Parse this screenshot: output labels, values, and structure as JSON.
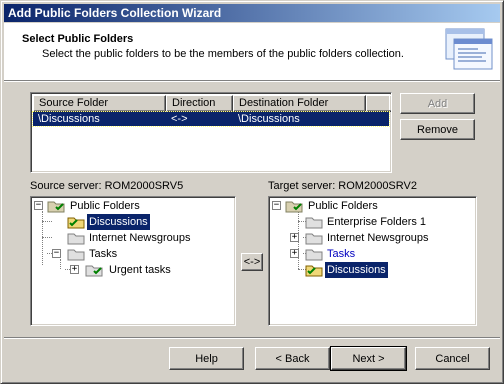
{
  "window": {
    "title": "Add Public Folders Collection Wizard"
  },
  "header": {
    "title": "Select Public Folders",
    "description": "Select the public folders to be the members of the public folders collection.",
    "graphic_icon": "wizard-window-graphic"
  },
  "collection_list": {
    "columns": [
      "Source Folder",
      "Direction",
      "Destination Folder"
    ],
    "rows": [
      {
        "source": "\\Discussions",
        "direction": "<->",
        "destination": "\\Discussions",
        "selected": true
      }
    ]
  },
  "buttons": {
    "add": "Add",
    "remove": "Remove",
    "transfer": "<->",
    "help": "Help",
    "back": "< Back",
    "next": "Next >",
    "cancel": "Cancel"
  },
  "source": {
    "label": "Source server: ROM2000SRV5",
    "tree": {
      "root": "Public Folders",
      "items": [
        {
          "label": "Discussions",
          "selected": true
        },
        {
          "label": "Internet Newsgroups"
        },
        {
          "label": "Tasks",
          "children": [
            {
              "label": "Urgent tasks"
            }
          ]
        }
      ]
    }
  },
  "target": {
    "label": "Target server: ROM2000SRV2",
    "tree": {
      "root": "Public Folders",
      "items": [
        {
          "label": "Enterprise Folders 1"
        },
        {
          "label": "Internet Newsgroups"
        },
        {
          "label": "Tasks",
          "highlight": true
        },
        {
          "label": "Discussions",
          "selected": true
        }
      ]
    }
  },
  "colors": {
    "selection": "#0a246a",
    "title_gradient_start": "#0a246a",
    "title_gradient_end": "#a6caf0",
    "face": "#d4d0c8",
    "folder_yellow": "#f0d878",
    "link_blue": "#0000c0"
  }
}
